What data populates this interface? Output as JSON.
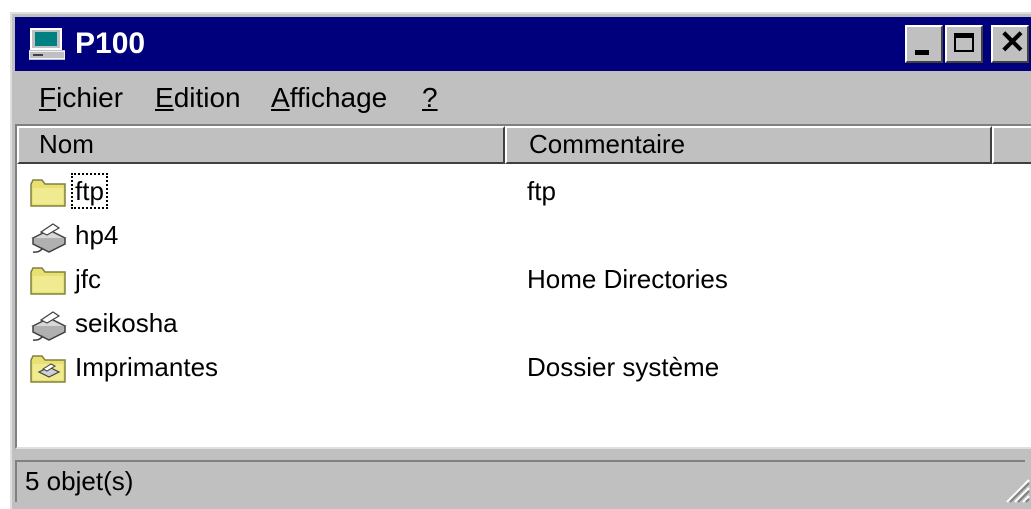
{
  "window": {
    "title": "P100",
    "title_icon": "computer-icon",
    "buttons": {
      "minimize": "minimize-icon",
      "maximize": "maximize-icon",
      "close": "close-icon"
    }
  },
  "menu": {
    "items": [
      {
        "mnemonic": "F",
        "rest": "ichier"
      },
      {
        "mnemonic": "E",
        "rest": "dition"
      },
      {
        "mnemonic": "A",
        "rest": "ffichage"
      },
      {
        "mnemonic": "?",
        "rest": ""
      }
    ]
  },
  "list": {
    "columns": [
      "Nom",
      "Commentaire",
      ""
    ],
    "rows": [
      {
        "name": "ftp",
        "comment": "ftp",
        "icon": "folder-icon"
      },
      {
        "name": "hp4",
        "comment": "",
        "icon": "printer-icon"
      },
      {
        "name": "jfc",
        "comment": "Home Directories",
        "icon": "folder-icon"
      },
      {
        "name": "seikosha",
        "comment": "",
        "icon": "printer-icon"
      },
      {
        "name": "Imprimantes",
        "comment": "Dossier système",
        "icon": "printers-folder-icon"
      }
    ]
  },
  "status": {
    "text": "5 objet(s)"
  },
  "colors": {
    "titlebar": "#00007c",
    "chrome": "#c0c0c0",
    "panel": "#ffffff"
  }
}
